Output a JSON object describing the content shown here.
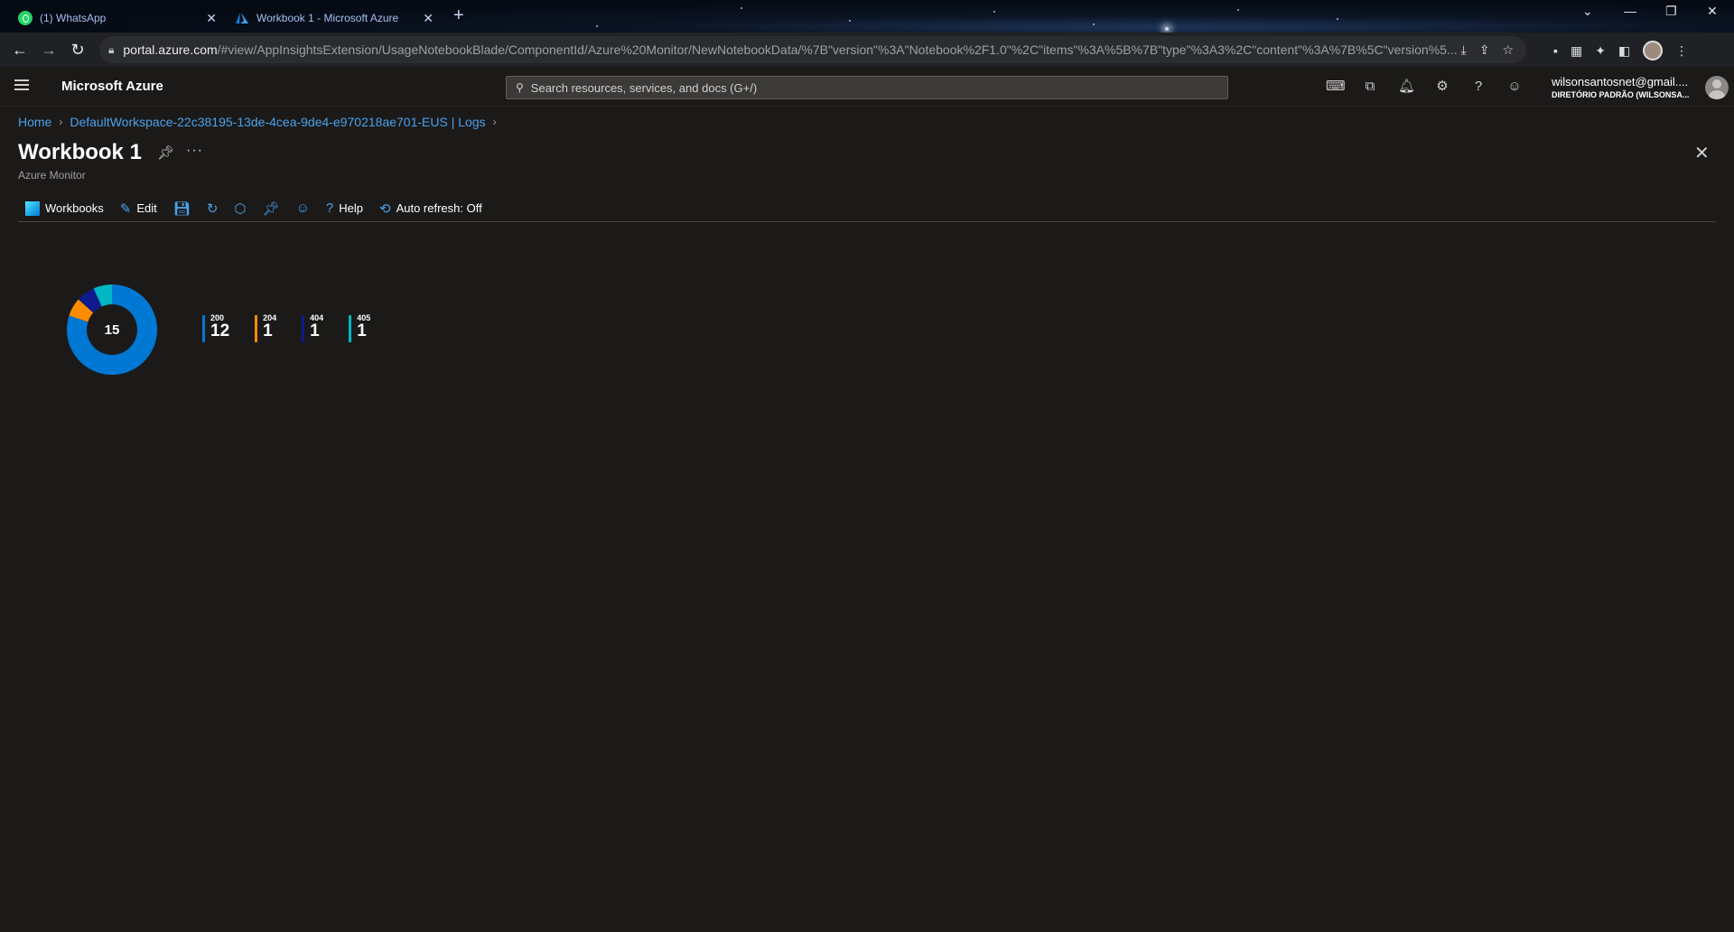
{
  "browser": {
    "tabs": [
      {
        "label": "(1) WhatsApp",
        "icon": "whatsapp-icon"
      },
      {
        "label": "Workbook 1 - Microsoft Azure",
        "icon": "azure-icon"
      }
    ],
    "url_host": "portal.azure.com",
    "url_path": "/#view/AppInsightsExtension/UsageNotebookBlade/ComponentId/Azure%20Monitor/NewNotebookData/%7B\"version\"%3A\"Notebook%2F1.0\"%2C\"items\"%3A%5B%7B\"type\"%3A3%2C\"content\"%3A%7B%5C\"version%5..."
  },
  "header": {
    "brand": "Microsoft Azure",
    "search_placeholder": "Search resources, services, and docs (G+/)",
    "account_email": "wilsonsantosnet@gmail....",
    "account_directory": "DIRETÓRIO PADRÃO (WILSONSA..."
  },
  "breadcrumb": {
    "home": "Home",
    "workspace": "DefaultWorkspace-22c38195-13de-4cea-9de4-e970218ae701-EUS | Logs"
  },
  "page": {
    "title": "Workbook 1",
    "subtitle": "Azure Monitor"
  },
  "commands": {
    "workbooks": "Workbooks",
    "edit": "Edit",
    "help": "Help",
    "auto_refresh": "Auto refresh: Off"
  },
  "chart_data": {
    "type": "pie",
    "total": "15",
    "categories": [
      "200",
      "204",
      "404",
      "405"
    ],
    "values": [
      12,
      1,
      1,
      1
    ],
    "colors": [
      "#0078d4",
      "#ff8c00",
      "#0f1a8c",
      "#00b7c3"
    ]
  },
  "legend": [
    {
      "key": "200",
      "value": "12",
      "color": "#0078d4"
    },
    {
      "key": "204",
      "value": "1",
      "color": "#ff8c00"
    },
    {
      "key": "404",
      "value": "1",
      "color": "#0f1a8c"
    },
    {
      "key": "405",
      "value": "1",
      "color": "#00b7c3"
    }
  ]
}
